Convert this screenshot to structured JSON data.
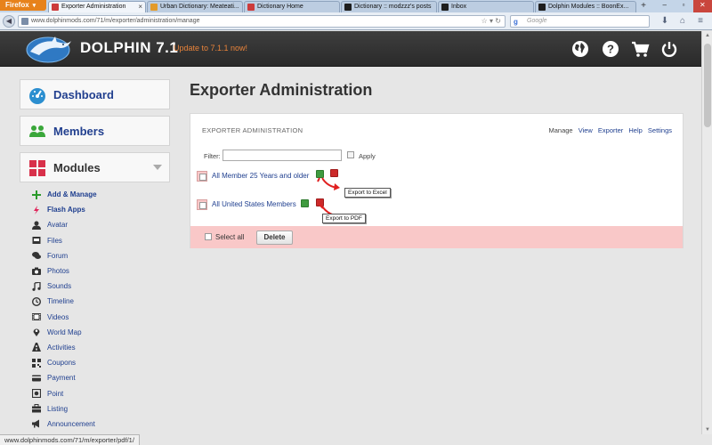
{
  "browser": {
    "menu_label": "Firefox",
    "tabs": [
      {
        "label": "Exporter Administration",
        "active": true,
        "favicon_color": "#cc3b3b"
      },
      {
        "label": "Urban Dictionary: Meateati...",
        "active": false,
        "favicon_color": "#e39b2b"
      },
      {
        "label": "Dictionary Home",
        "active": false,
        "favicon_color": "#cc3b3b"
      },
      {
        "label": "Dictionary :: modzzz's posts",
        "active": false,
        "favicon_color": "#1e1e1e"
      },
      {
        "label": "Inbox",
        "active": false,
        "favicon_color": "#1e1e1e"
      },
      {
        "label": "Dolphin Modules :: BoonEx...",
        "active": false,
        "favicon_color": "#1e1e1e"
      }
    ],
    "new_tab_label": "+",
    "url": "www.dolphinmods.com/71/m/exporter/administration/manage",
    "search_placeholder": "Google",
    "status_text": "www.dolphinmods.com/71/m/exporter/pdf/1/"
  },
  "site_header": {
    "brand": "DOLPHIN 7.1",
    "update_link": "Update to 7.1.1 now!",
    "icons": [
      "globe-icon",
      "help-icon",
      "cart-icon",
      "power-icon"
    ]
  },
  "sidebar": {
    "dashboard_label": "Dashboard",
    "members_label": "Members",
    "modules_label": "Modules",
    "items": [
      {
        "label": "Add & Manage",
        "icon": "plus-icon",
        "bold": true
      },
      {
        "label": "Flash Apps",
        "icon": "flash-icon",
        "bold": true
      },
      {
        "label": "Avatar",
        "icon": "avatar-icon",
        "bold": false
      },
      {
        "label": "Files",
        "icon": "files-icon",
        "bold": false
      },
      {
        "label": "Forum",
        "icon": "forum-icon",
        "bold": false
      },
      {
        "label": "Photos",
        "icon": "photos-icon",
        "bold": false
      },
      {
        "label": "Sounds",
        "icon": "sounds-icon",
        "bold": false
      },
      {
        "label": "Timeline",
        "icon": "timeline-icon",
        "bold": false
      },
      {
        "label": "Videos",
        "icon": "videos-icon",
        "bold": false
      },
      {
        "label": "World Map",
        "icon": "map-pin-icon",
        "bold": false
      },
      {
        "label": "Activities",
        "icon": "activities-icon",
        "bold": false
      },
      {
        "label": "Coupons",
        "icon": "coupons-icon",
        "bold": false
      },
      {
        "label": "Payment",
        "icon": "payment-icon",
        "bold": false
      },
      {
        "label": "Point",
        "icon": "point-icon",
        "bold": false
      },
      {
        "label": "Listing",
        "icon": "listing-icon",
        "bold": false
      },
      {
        "label": "Announcement",
        "icon": "announcement-icon",
        "bold": false
      }
    ]
  },
  "main": {
    "page_title": "Exporter Administration",
    "panel_title": "EXPORTER ADMINISTRATION",
    "panel_links": [
      "Manage",
      "View",
      "Exporter",
      "Help",
      "Settings"
    ],
    "filter_label": "Filter:",
    "filter_value": "",
    "apply_label": "Apply",
    "rows": [
      {
        "label": "All Member 25 Years and older"
      },
      {
        "label": "All United States Members"
      }
    ],
    "tooltip_excel": "Export to Excel",
    "tooltip_pdf": "Export to PDF",
    "select_all_label": "Select all",
    "delete_label": "Delete"
  },
  "colors": {
    "header_bg": "#333333",
    "accent_orange": "#e8833a",
    "link_blue": "#1f3f8f",
    "bulk_pink": "#f9c8c8",
    "annotation_red": "#e02020"
  }
}
